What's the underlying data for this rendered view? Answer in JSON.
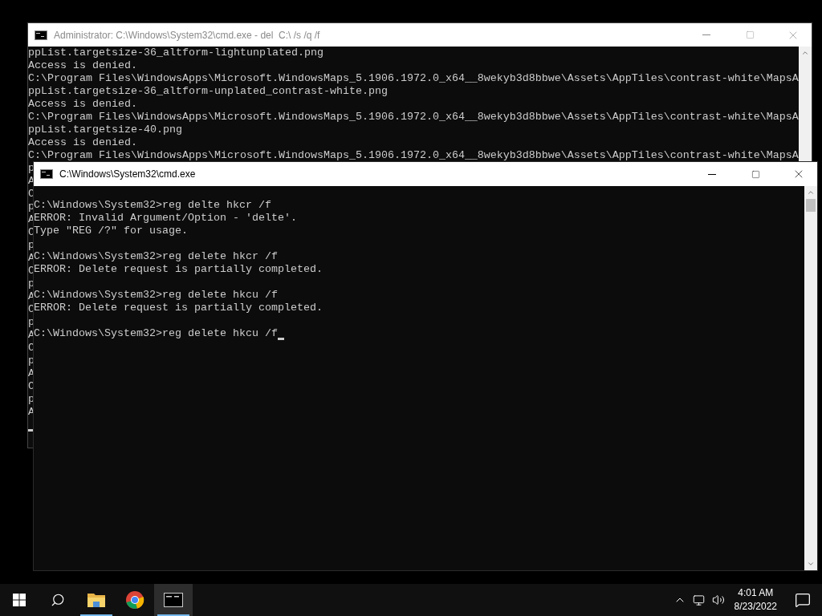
{
  "back_window": {
    "title": "Administrator: C:\\Windows\\System32\\cmd.exe - del  C:\\ /s /q /f",
    "active": false,
    "cursor": true,
    "lines": [
      "ppList.targetsize-36_altform-lightunplated.png",
      "Access is denied.",
      "C:\\Program Files\\WindowsApps\\Microsoft.WindowsMaps_5.1906.1972.0_x64__8wekyb3d8bbwe\\Assets\\AppTiles\\contrast-white\\MapsA",
      "ppList.targetsize-36_altform-unplated_contrast-white.png",
      "Access is denied.",
      "C:\\Program Files\\WindowsApps\\Microsoft.WindowsMaps_5.1906.1972.0_x64__8wekyb3d8bbwe\\Assets\\AppTiles\\contrast-white\\MapsA",
      "ppList.targetsize-40.png",
      "Access is denied.",
      "C:\\Program Files\\WindowsApps\\Microsoft.WindowsMaps_5.1906.1972.0_x64__8wekyb3d8bbwe\\Assets\\AppTiles\\contrast-white\\MapsA",
      "p",
      "A",
      "C",
      "p",
      "A",
      "C",
      "p",
      "A",
      "C",
      "p",
      "A",
      "C",
      "p",
      "A",
      "C",
      "p",
      "A",
      "C",
      "p",
      "A"
    ]
  },
  "front_window": {
    "title": "C:\\Windows\\System32\\cmd.exe",
    "active": true,
    "commands": [
      {
        "prompt": "C:\\Windows\\System32>",
        "command": "reg delte hkcr /f",
        "output": [
          "ERROR: Invalid Argument/Option - 'delte'.",
          "Type \"REG /?\" for usage."
        ]
      },
      {
        "prompt": "C:\\Windows\\System32>",
        "command": "reg delete hkcr /f",
        "output": [
          "ERROR: Delete request is partially completed."
        ]
      },
      {
        "prompt": "C:\\Windows\\System32>",
        "command": "reg delete hkcu /f",
        "output": [
          "ERROR: Delete request is partially completed."
        ]
      },
      {
        "prompt": "C:\\Windows\\System32>",
        "command": "reg delete hkcu /f",
        "cursor": true
      }
    ]
  },
  "taskbar": {
    "apps": [
      {
        "kind": "folder",
        "running": true,
        "selected": false
      },
      {
        "kind": "browser",
        "running": false,
        "selected": false
      },
      {
        "kind": "terminal",
        "running": true,
        "selected": true
      }
    ],
    "clock": {
      "time": "4:01 AM",
      "date": "8/23/2022"
    }
  }
}
